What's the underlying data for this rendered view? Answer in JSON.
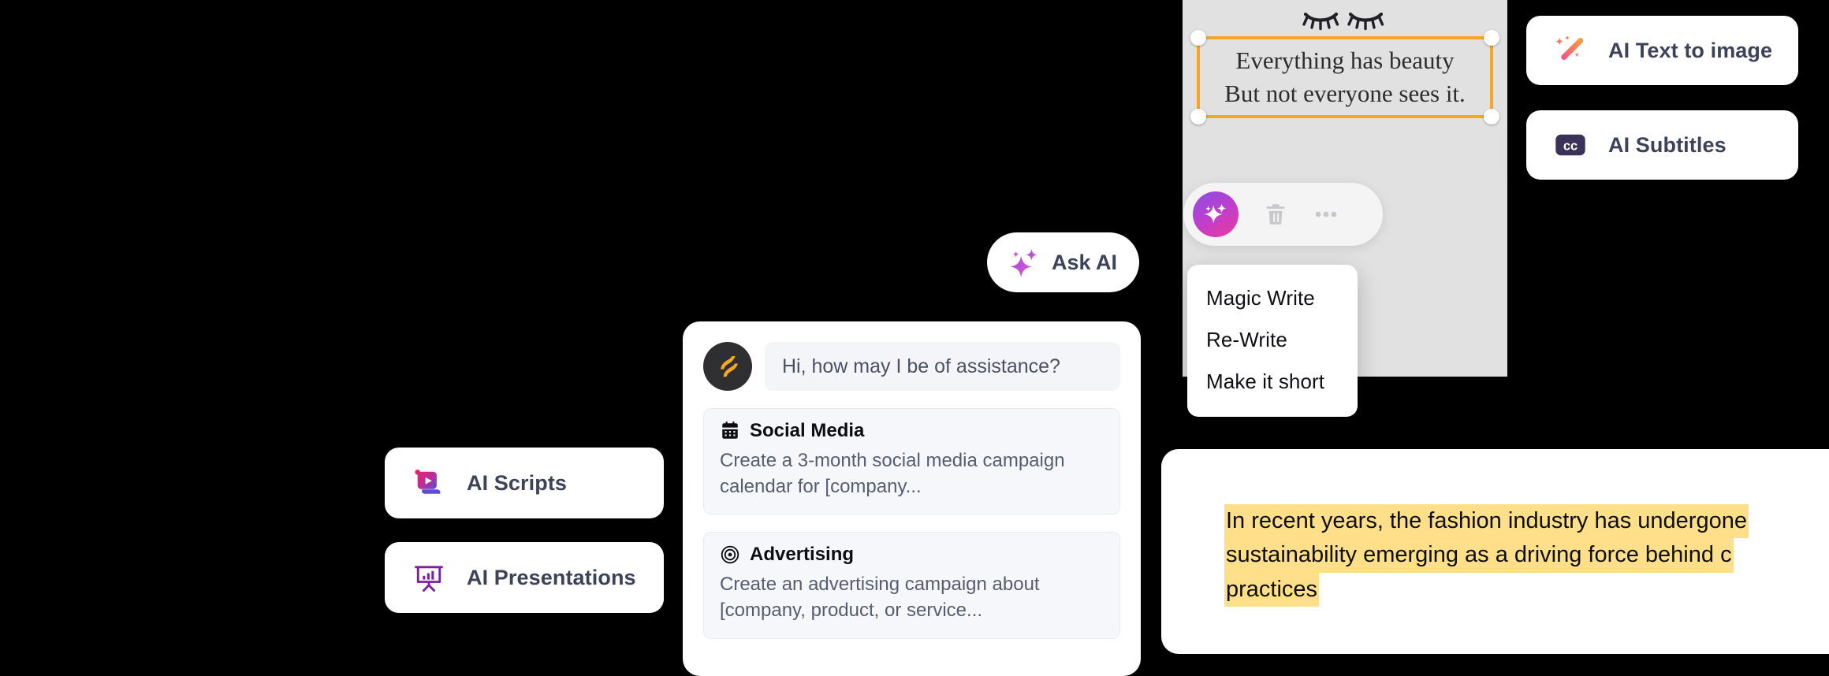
{
  "theme": {
    "background": "#000000",
    "canvas_bg": "#e1e1e1",
    "selection_accent": "#f5a623",
    "highlight": "#ffdf89",
    "card_text": "#3c4257"
  },
  "feature_cards": [
    {
      "id": "ai-text-to-image",
      "label": "AI Text to image",
      "icon": "magic-wand-icon"
    },
    {
      "id": "ai-subtitles",
      "label": "AI Subtitles",
      "icon": "closed-captions-icon"
    },
    {
      "id": "ai-scripts",
      "label": "AI Scripts",
      "icon": "script-video-icon"
    },
    {
      "id": "ai-presentations",
      "label": "AI Presentations",
      "icon": "presentation-chart-icon"
    }
  ],
  "canvas": {
    "decoration_icon": "closed-eyes-lashes-icon",
    "text_block": {
      "line1": "Everything has beauty",
      "line2": "But not everyone sees it."
    },
    "selection": {
      "handles": 4,
      "color": "#f5a623"
    }
  },
  "element_toolbar": {
    "magic_button": "magic-sparkle-icon",
    "delete_button": "trash-icon",
    "more_button": "more-horizontal-icon"
  },
  "ai_menu": {
    "items": [
      {
        "label": "Magic Write"
      },
      {
        "label": "Re-Write"
      },
      {
        "label": "Make it short"
      }
    ]
  },
  "ask_ai": {
    "label": "Ask AI",
    "icon": "sparkles-icon"
  },
  "chat": {
    "avatar_icon": "assistant-logo-icon",
    "greeting": "Hi, how may I be of assistance?",
    "suggestions": [
      {
        "icon": "calendar-icon",
        "title": "Social Media",
        "body": "Create a 3-month social media campaign calendar for [company..."
      },
      {
        "icon": "target-icon",
        "title": "Advertising",
        "body": "Create an advertising campaign about [company, product, or service..."
      }
    ]
  },
  "document": {
    "highlighted_lines": [
      "In recent years, the fashion industry has undergone",
      "sustainability emerging as a driving force behind c",
      "practices"
    ]
  }
}
